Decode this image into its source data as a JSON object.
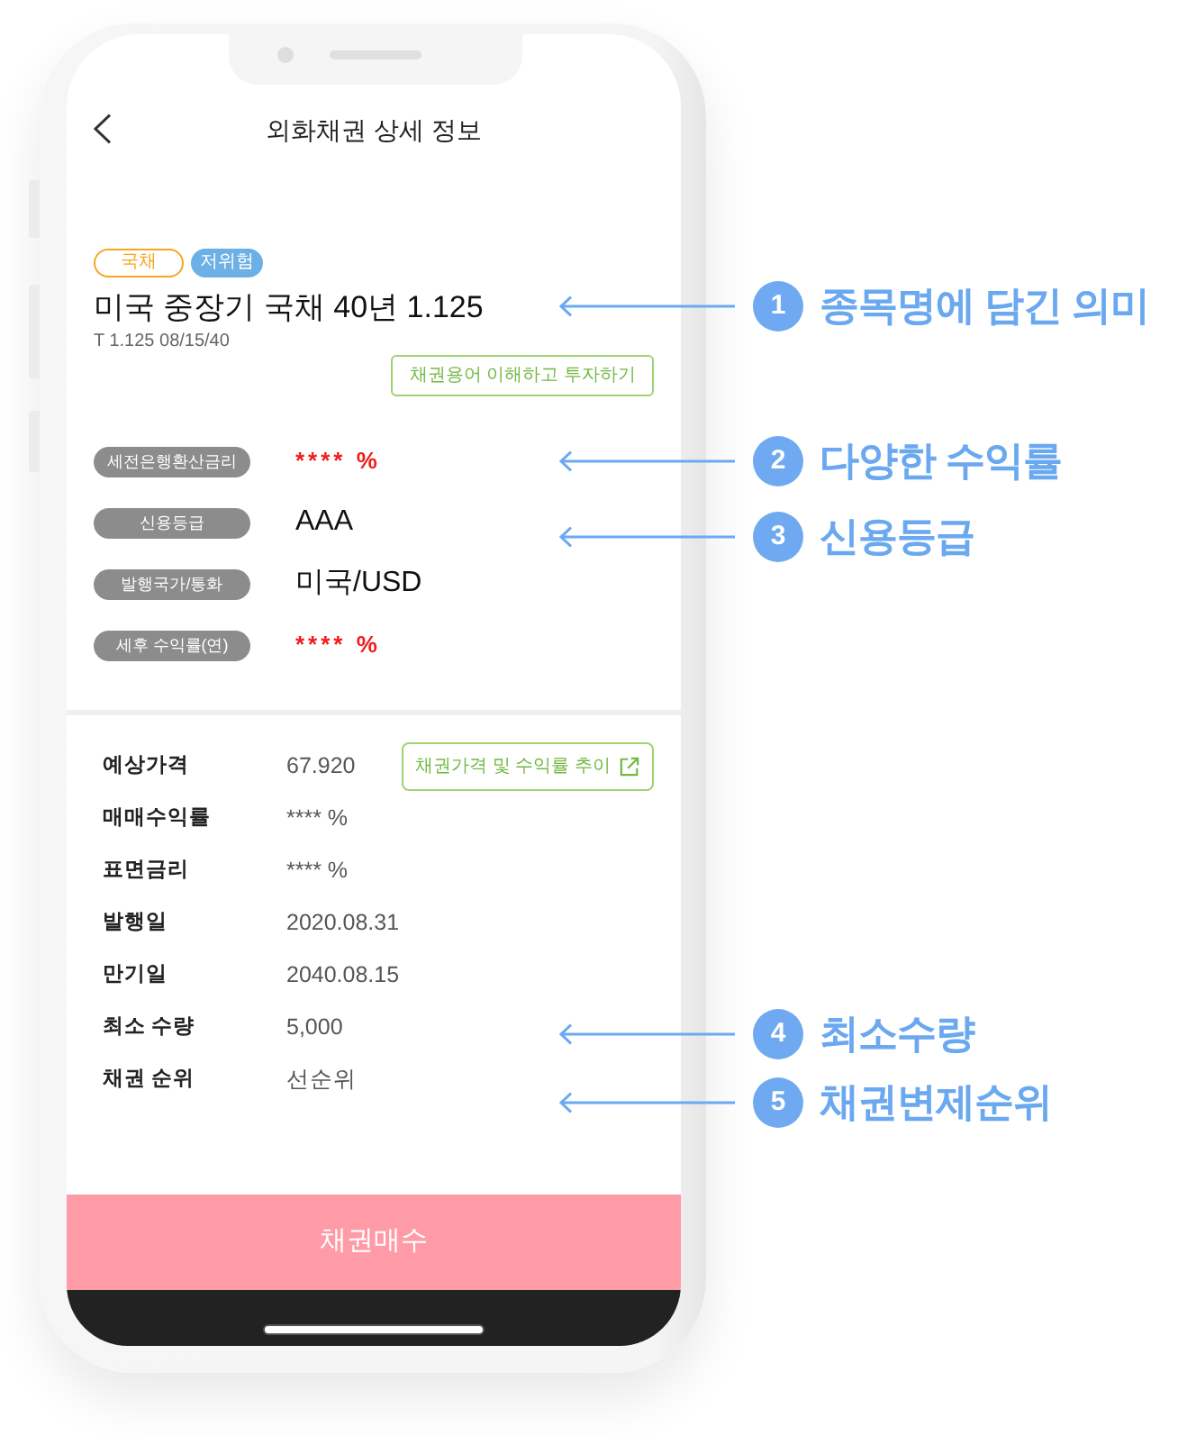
{
  "screen": {
    "title": "외화채권 상세 정보"
  },
  "bond": {
    "tags": [
      {
        "label": "국채",
        "kind": "outline",
        "color": "#f5a623"
      },
      {
        "label": "저위험",
        "kind": "filled",
        "color": "#6cb0e6"
      }
    ],
    "name": "미국 중장기 국채 40년 1.125",
    "code": "T 1.125 08/15/40",
    "guide_button": "채권용어 이해하고 투자하기"
  },
  "key_facts": [
    {
      "label": "세전은행환산금리",
      "value": "**** %",
      "kind": "masked"
    },
    {
      "label": "신용등급",
      "value": "AAA",
      "kind": "plain"
    },
    {
      "label": "발행국가/통화",
      "value": "미국/USD",
      "kind": "plain"
    },
    {
      "label": "세후 수익률(연)",
      "value": "**** %",
      "kind": "masked"
    }
  ],
  "details": {
    "rows": [
      {
        "label": "예상가격",
        "value": "67.920"
      },
      {
        "label": "매매수익률",
        "value": "**** %"
      },
      {
        "label": "표면금리",
        "value": "**** %"
      },
      {
        "label": "발행일",
        "value": "2020.08.31"
      },
      {
        "label": "만기일",
        "value": "2040.08.15"
      },
      {
        "label": "최소 수량",
        "value": "5,000"
      },
      {
        "label": "채권 순위",
        "value": "선순위"
      }
    ],
    "trend_button": "채권가격 및 수익률 추이"
  },
  "buy_button": "채권매수",
  "callouts": [
    {
      "number": "1",
      "label": "종목명에 담긴 의미"
    },
    {
      "number": "2",
      "label": "다양한 수익률"
    },
    {
      "number": "3",
      "label": "신용등급"
    },
    {
      "number": "4",
      "label": "최소수량"
    },
    {
      "number": "5",
      "label": "채권변제순위"
    }
  ]
}
